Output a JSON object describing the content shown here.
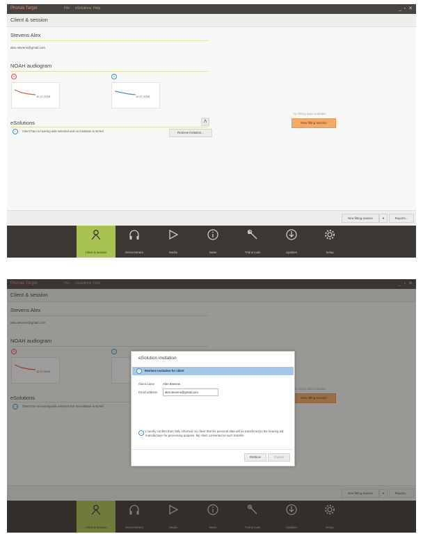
{
  "window": {
    "title": "Phonak Target",
    "menu": [
      "File",
      "eSolutions",
      "Help"
    ],
    "controls": "_ ▫ ✕"
  },
  "section": {
    "title": "Client & session"
  },
  "client": {
    "name": "Stevens Alex",
    "email": "alex.stevens@gmail.com"
  },
  "audiogram": {
    "title": "NOAH audiogram",
    "right": {
      "icon": "right-ear-icon",
      "symbol": "R",
      "date": "12.07.2018",
      "color": "#d9534f"
    },
    "left": {
      "icon": "left-ear-icon",
      "symbol": "L",
      "date": "12.07.2018",
      "color": "#3a8fd0"
    }
  },
  "esolutions": {
    "title": "eSolutions",
    "collapse": "ᐱ",
    "info_symbol": "i",
    "message": "Client has no hearing aids selected and no invitation is stored",
    "retrieve_button": "Retrieve invitation..."
  },
  "fitting": {
    "no_data": "No fitting data available",
    "new_session_button": "New fitting session",
    "accent": "#f2ab66"
  },
  "bottombar": {
    "new_session": "New fitting session",
    "dropdown": "▼",
    "reports": "Reports..."
  },
  "nav": [
    {
      "label": "Client & session",
      "icon": "person-icon",
      "active": true
    },
    {
      "label": "Demonstrator",
      "icon": "headphones-icon",
      "active": false
    },
    {
      "label": "Media",
      "icon": "play-icon",
      "active": false
    },
    {
      "label": "News",
      "icon": "info-circle-icon",
      "active": false
    },
    {
      "label": "Trial & tools",
      "icon": "wrench-icon",
      "active": false
    },
    {
      "label": "Updates",
      "icon": "download-icon",
      "active": false
    },
    {
      "label": "Setup",
      "icon": "gear-icon",
      "active": false
    }
  ],
  "nav_accent": "#a9c353",
  "dialog": {
    "title": "eSolution invitation",
    "header": "Retrieve invitation for client",
    "client_name_label": "Client name",
    "client_name_value": "Alex Stevens",
    "email_label": "Email address",
    "email_value": "alex.stevens@gmail.com",
    "confirm_text": "I hereby confirm that I fully informed my client that his personal data will be transferred to the hearing aid manufacturer for processing purpose. My client consented to such transfer.",
    "retrieve_button": "Retrieve",
    "cancel_button": "Cancel"
  }
}
